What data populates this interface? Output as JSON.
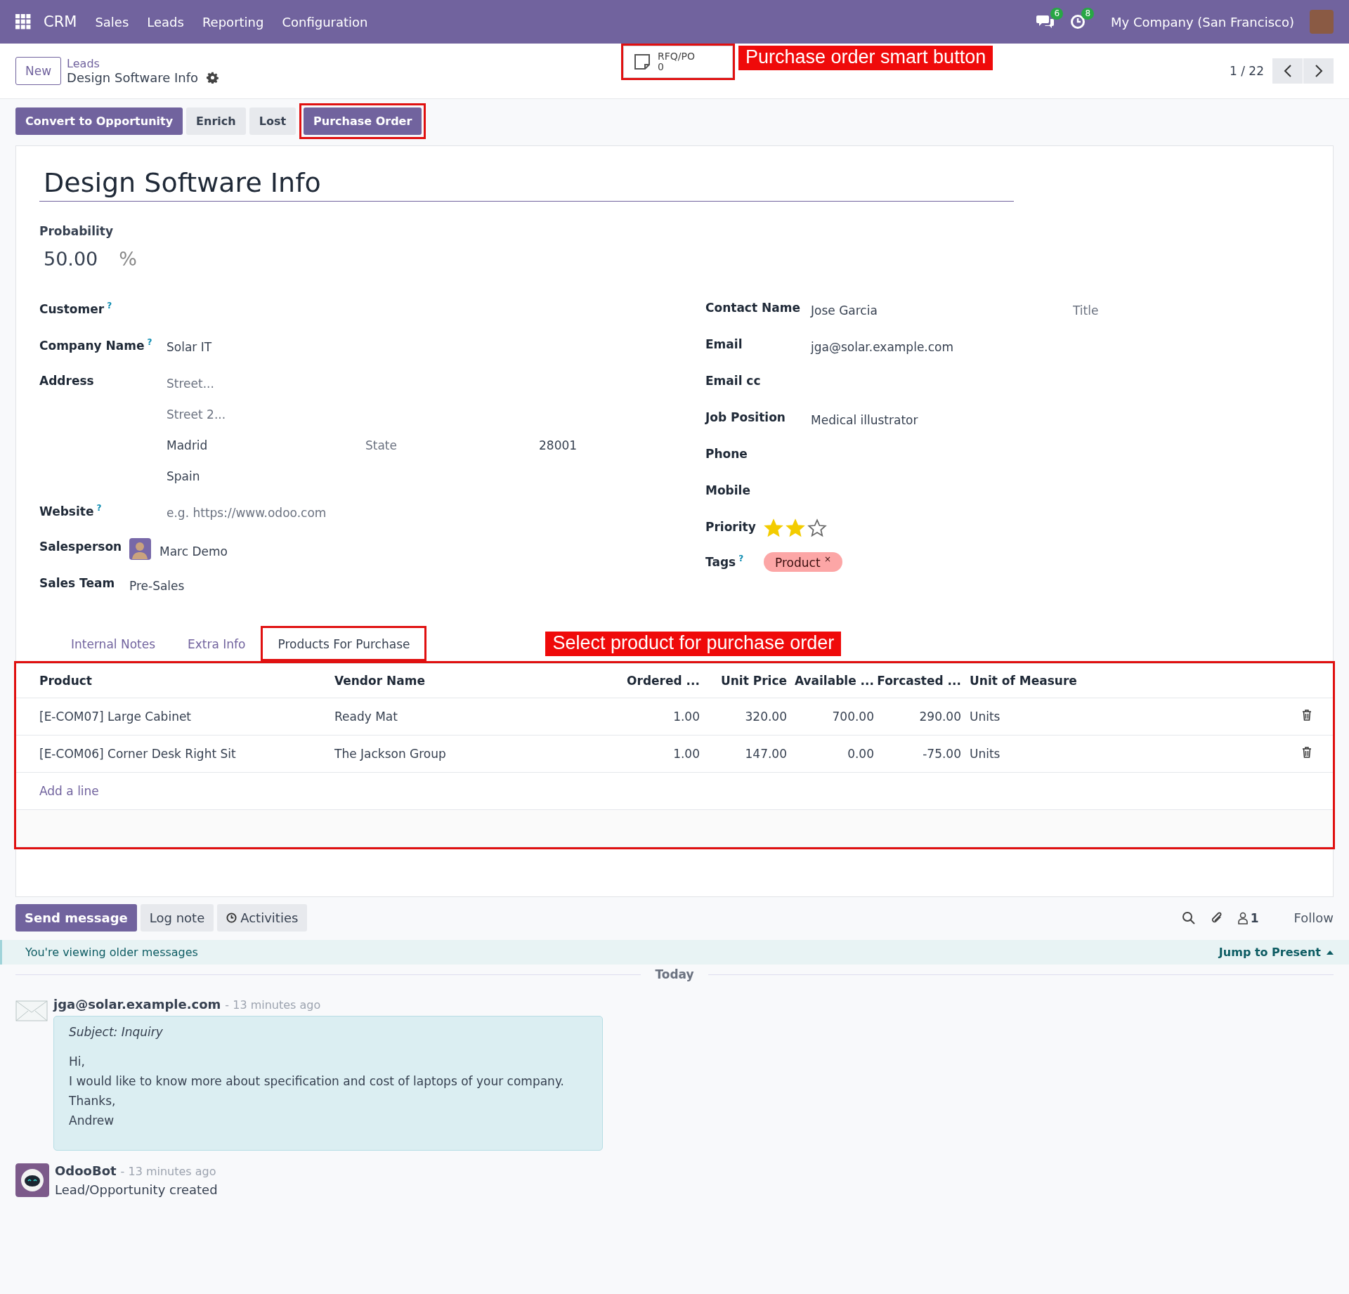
{
  "navbar": {
    "app": "CRM",
    "menus": [
      "Sales",
      "Leads",
      "Reporting",
      "Configuration"
    ],
    "messages_count": "6",
    "activities_count": "8",
    "company": "My Company (San Francisco)"
  },
  "control_panel": {
    "new_button": "New",
    "breadcrumb": "Leads",
    "record": "Design Software Info",
    "smart_button": {
      "label": "RFQ/PO",
      "value": "0",
      "annotated": true
    },
    "pager": "1 / 22"
  },
  "annotations": [
    "Purchase order smart button",
    "Select product for purchase order"
  ],
  "action_buttons": [
    {
      "label": "Convert to Opportunity",
      "primary": true,
      "annotated": false
    },
    {
      "label": "Enrich",
      "primary": false,
      "annotated": false
    },
    {
      "label": "Lost",
      "primary": false,
      "annotated": false
    },
    {
      "label": "Purchase Order",
      "primary": true,
      "annotated": true
    }
  ],
  "form": {
    "title": "Design Software Info",
    "probability_label": "Probability",
    "probability": "50.00",
    "percent": "%",
    "customer": {
      "label": "Customer",
      "help": "?"
    },
    "company": {
      "label": "Company Name",
      "help": "?",
      "value": "Solar IT"
    },
    "address": {
      "label": "Address",
      "street": "Street...",
      "street2": "Street 2...",
      "city": "Madrid",
      "state": "State",
      "zip": "28001",
      "country": "Spain"
    },
    "website": {
      "label": "Website",
      "help": "?",
      "placeholder": "e.g. https://www.odoo.com"
    },
    "salesperson": {
      "label": "Salesperson",
      "value": "Marc Demo"
    },
    "sales_team": {
      "label": "Sales Team",
      "value": "Pre-Sales"
    },
    "contact": {
      "label": "Contact Name",
      "value": "Jose Garcia",
      "title_placeholder": "Title"
    },
    "right_fields": [
      {
        "label": "Email",
        "value": "jga@solar.example.com"
      },
      {
        "label": "Email cc"
      },
      {
        "label": "Job Position",
        "value": "Medical illustrator"
      },
      {
        "label": "Phone"
      },
      {
        "label": "Mobile"
      }
    ],
    "priority": {
      "label": "Priority",
      "stars": 2
    },
    "tags": {
      "label": "Tags",
      "help": "?",
      "items": [
        {
          "label": "Product",
          "remove": "×"
        }
      ]
    }
  },
  "tabs": [
    {
      "label": "Internal Notes",
      "selected": false,
      "annotated": false
    },
    {
      "label": "Extra Info",
      "selected": false,
      "annotated": false
    },
    {
      "label": "Products For Purchase",
      "selected": true,
      "annotated": true
    }
  ],
  "table": {
    "annotated": true,
    "columns": [
      "Product",
      "Vendor Name",
      "Ordered ...",
      "Unit Price",
      "Available ...",
      "Forcasted ...",
      "Unit of Measure"
    ],
    "rows": [
      [
        "[E-COM07] Large Cabinet",
        "Ready Mat",
        "1.00",
        "320.00",
        "700.00",
        "290.00",
        "Units"
      ],
      [
        "[E-COM06] Corner Desk Right Sit",
        "The Jackson Group",
        "1.00",
        "147.00",
        "0.00",
        "-75.00",
        "Units"
      ]
    ],
    "add_line": "Add a line"
  },
  "chatter": {
    "buttons": [
      {
        "label": "Send message",
        "primary": true,
        "kind": "plain"
      },
      {
        "label": "Log note",
        "primary": false,
        "kind": "plain"
      },
      {
        "label": "Activities",
        "primary": false,
        "kind": "clock"
      }
    ],
    "followers": "1",
    "follow": "Follow",
    "banner": "You're viewing older messages",
    "jump": "Jump to Present",
    "separator": "Today",
    "messages": [
      {
        "kind": "email",
        "author": "jga@solar.example.com",
        "time": "- 13 minutes ago",
        "subject": "Subject: Inquiry",
        "lines": [
          "Hi,",
          "I would like to know more about specification and cost of laptops of your company.",
          "Thanks,",
          "Andrew"
        ]
      },
      {
        "kind": "bot",
        "author": "OdooBot",
        "time": "- 13 minutes ago",
        "text": "Lead/Opportunity created"
      }
    ]
  }
}
